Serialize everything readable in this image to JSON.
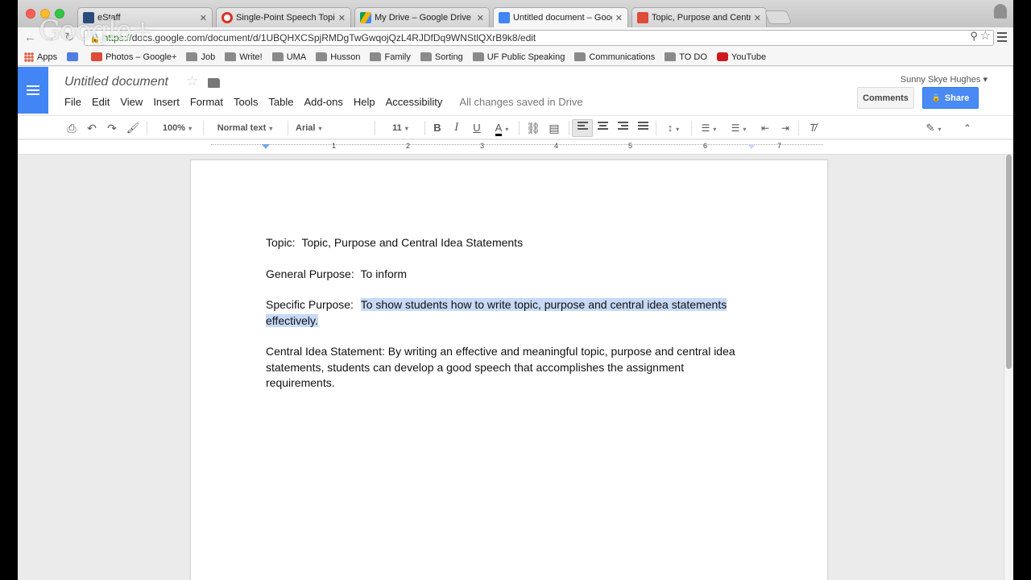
{
  "browser": {
    "tabs": [
      {
        "title": "eStaff",
        "favicon": "estaff-favicon",
        "color": "#2a4b7c",
        "active": false
      },
      {
        "title": "Single-Point Speech Topic",
        "favicon": "lifesaver-favicon",
        "color": "#d93025",
        "active": false
      },
      {
        "title": "My Drive – Google Drive",
        "favicon": "drive-favicon",
        "color": "#f4b400",
        "active": false
      },
      {
        "title": "Untitled document – Goog",
        "favicon": "docs-favicon",
        "color": "#4285f4",
        "active": true
      },
      {
        "title": "Topic, Purpose and Centra",
        "favicon": "gplus-favicon",
        "color": "#dd4b39",
        "active": false
      }
    ],
    "url_scheme": "https://",
    "url_rest": "docs.google.com/document/d/1UBQHXCSpjRMDgTwGwqojQzL4RJDfDq9WNStlQXrB9k8/edit",
    "bookmarks": [
      {
        "label": "Apps",
        "icon": "apps-grid-icon"
      },
      {
        "label": "",
        "icon": "google-8-icon"
      },
      {
        "label": "Photos – Google+",
        "icon": "gplus-icon"
      },
      {
        "label": "Job",
        "icon": "folder-icon"
      },
      {
        "label": "Write!",
        "icon": "folder-icon"
      },
      {
        "label": "UMA",
        "icon": "folder-icon"
      },
      {
        "label": "Husson",
        "icon": "folder-icon"
      },
      {
        "label": "Family",
        "icon": "folder-icon"
      },
      {
        "label": "Sorting",
        "icon": "folder-icon"
      },
      {
        "label": "UF Public Speaking",
        "icon": "folder-icon"
      },
      {
        "label": "Communications",
        "icon": "folder-icon"
      },
      {
        "label": "TO DO",
        "icon": "folder-icon"
      },
      {
        "label": "YouTube",
        "icon": "youtube-icon"
      }
    ],
    "watermark": "Google+"
  },
  "docs": {
    "title": "Untitled document",
    "menu": [
      "File",
      "Edit",
      "View",
      "Insert",
      "Format",
      "Tools",
      "Table",
      "Add-ons",
      "Help",
      "Accessibility"
    ],
    "save_status": "All changes saved in Drive",
    "user": "Sunny Skye Hughes",
    "comments_label": "Comments",
    "share_label": "Share",
    "accent": "#4285f4"
  },
  "toolbar": {
    "zoom": "100%",
    "style": "Normal text",
    "font": "Arial",
    "size": "11",
    "bold": "B",
    "italic": "I",
    "underline": "U",
    "text_color": "A",
    "text_color_swatch": "#000000"
  },
  "ruler": {
    "numbers": [
      "1",
      "2",
      "3",
      "4",
      "5",
      "6",
      "7"
    ]
  },
  "document": {
    "topic_label": "Topic:",
    "topic_value": "Topic, Purpose and Central Idea Statements",
    "general_label": "General Purpose:",
    "general_value": "To inform",
    "specific_label": "Specific Purpose:",
    "specific_value": "To show students how to write topic, purpose and central idea statements effectively.",
    "central_label": "Central Idea Statement:",
    "central_value": "By writing an effective and meaningful topic, purpose and central idea statements, students can develop a good speech that accomplishes the assignment requirements.",
    "highlight_color": "#c6d9f6"
  }
}
